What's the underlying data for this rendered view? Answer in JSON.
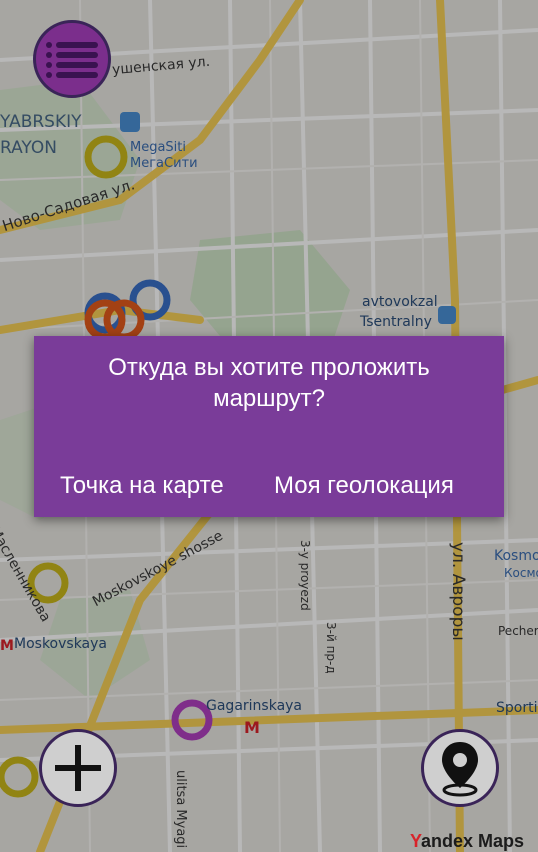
{
  "map": {
    "labels": {
      "ushenskaya": "ушенская ул.",
      "oktyabrskiy": "YABRSKIY",
      "rayon": "RAYON",
      "megasiti_lat": "MegaSiti",
      "megasiti_cyr": "МегаСити",
      "novo_sadovaya": "Ново-Садовая ул.",
      "avtovokzal": "avtovokzal",
      "tsentralny": "Tsentralny",
      "moskovskoye": "Moskovskoye shosse",
      "maslennikova": "Масленникова",
      "moskovskaya": "Moskovskaya",
      "proyezd": "3-y proyezd",
      "proyezd_cyr": "3-й пр-д",
      "aurora": "ул. Авроры",
      "kosmo_lat": "Kosmo",
      "kosmo_cyr": "Космо",
      "pecher": "Pecher",
      "gagarinskaya": "Gagarinskaya",
      "sporti": "Sporti",
      "myagi": "ulitsa Myagi"
    }
  },
  "dialog": {
    "message": "Откуда вы хотите проложить маршрут?",
    "point_on_map": "Точка на карте",
    "my_location": "Моя геолокация"
  },
  "attribution": {
    "y": "Y",
    "rest": "andex Maps"
  },
  "colors": {
    "dialog_bg": "#7a3c99",
    "accent": "#7b2e8c",
    "button_border": "#3a2458"
  },
  "icons": {
    "menu": "list-menu-icon",
    "add": "plus-icon",
    "geo": "location-pin-icon"
  }
}
